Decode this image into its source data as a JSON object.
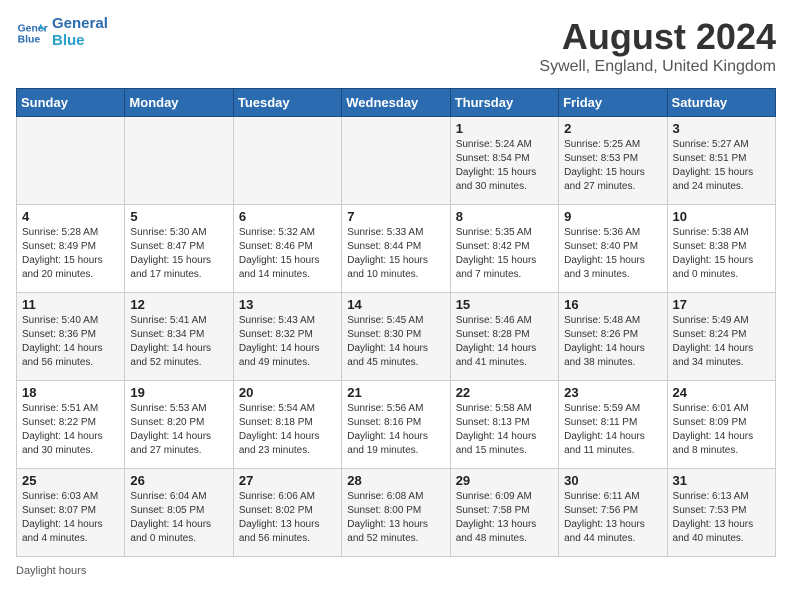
{
  "header": {
    "logo_line1": "General",
    "logo_line2": "Blue",
    "month_title": "August 2024",
    "location": "Sywell, England, United Kingdom"
  },
  "days_of_week": [
    "Sunday",
    "Monday",
    "Tuesday",
    "Wednesday",
    "Thursday",
    "Friday",
    "Saturday"
  ],
  "weeks": [
    [
      {
        "day": "",
        "content": ""
      },
      {
        "day": "",
        "content": ""
      },
      {
        "day": "",
        "content": ""
      },
      {
        "day": "",
        "content": ""
      },
      {
        "day": "1",
        "content": "Sunrise: 5:24 AM\nSunset: 8:54 PM\nDaylight: 15 hours\nand 30 minutes."
      },
      {
        "day": "2",
        "content": "Sunrise: 5:25 AM\nSunset: 8:53 PM\nDaylight: 15 hours\nand 27 minutes."
      },
      {
        "day": "3",
        "content": "Sunrise: 5:27 AM\nSunset: 8:51 PM\nDaylight: 15 hours\nand 24 minutes."
      }
    ],
    [
      {
        "day": "4",
        "content": "Sunrise: 5:28 AM\nSunset: 8:49 PM\nDaylight: 15 hours\nand 20 minutes."
      },
      {
        "day": "5",
        "content": "Sunrise: 5:30 AM\nSunset: 8:47 PM\nDaylight: 15 hours\nand 17 minutes."
      },
      {
        "day": "6",
        "content": "Sunrise: 5:32 AM\nSunset: 8:46 PM\nDaylight: 15 hours\nand 14 minutes."
      },
      {
        "day": "7",
        "content": "Sunrise: 5:33 AM\nSunset: 8:44 PM\nDaylight: 15 hours\nand 10 minutes."
      },
      {
        "day": "8",
        "content": "Sunrise: 5:35 AM\nSunset: 8:42 PM\nDaylight: 15 hours\nand 7 minutes."
      },
      {
        "day": "9",
        "content": "Sunrise: 5:36 AM\nSunset: 8:40 PM\nDaylight: 15 hours\nand 3 minutes."
      },
      {
        "day": "10",
        "content": "Sunrise: 5:38 AM\nSunset: 8:38 PM\nDaylight: 15 hours\nand 0 minutes."
      }
    ],
    [
      {
        "day": "11",
        "content": "Sunrise: 5:40 AM\nSunset: 8:36 PM\nDaylight: 14 hours\nand 56 minutes."
      },
      {
        "day": "12",
        "content": "Sunrise: 5:41 AM\nSunset: 8:34 PM\nDaylight: 14 hours\nand 52 minutes."
      },
      {
        "day": "13",
        "content": "Sunrise: 5:43 AM\nSunset: 8:32 PM\nDaylight: 14 hours\nand 49 minutes."
      },
      {
        "day": "14",
        "content": "Sunrise: 5:45 AM\nSunset: 8:30 PM\nDaylight: 14 hours\nand 45 minutes."
      },
      {
        "day": "15",
        "content": "Sunrise: 5:46 AM\nSunset: 8:28 PM\nDaylight: 14 hours\nand 41 minutes."
      },
      {
        "day": "16",
        "content": "Sunrise: 5:48 AM\nSunset: 8:26 PM\nDaylight: 14 hours\nand 38 minutes."
      },
      {
        "day": "17",
        "content": "Sunrise: 5:49 AM\nSunset: 8:24 PM\nDaylight: 14 hours\nand 34 minutes."
      }
    ],
    [
      {
        "day": "18",
        "content": "Sunrise: 5:51 AM\nSunset: 8:22 PM\nDaylight: 14 hours\nand 30 minutes."
      },
      {
        "day": "19",
        "content": "Sunrise: 5:53 AM\nSunset: 8:20 PM\nDaylight: 14 hours\nand 27 minutes."
      },
      {
        "day": "20",
        "content": "Sunrise: 5:54 AM\nSunset: 8:18 PM\nDaylight: 14 hours\nand 23 minutes."
      },
      {
        "day": "21",
        "content": "Sunrise: 5:56 AM\nSunset: 8:16 PM\nDaylight: 14 hours\nand 19 minutes."
      },
      {
        "day": "22",
        "content": "Sunrise: 5:58 AM\nSunset: 8:13 PM\nDaylight: 14 hours\nand 15 minutes."
      },
      {
        "day": "23",
        "content": "Sunrise: 5:59 AM\nSunset: 8:11 PM\nDaylight: 14 hours\nand 11 minutes."
      },
      {
        "day": "24",
        "content": "Sunrise: 6:01 AM\nSunset: 8:09 PM\nDaylight: 14 hours\nand 8 minutes."
      }
    ],
    [
      {
        "day": "25",
        "content": "Sunrise: 6:03 AM\nSunset: 8:07 PM\nDaylight: 14 hours\nand 4 minutes."
      },
      {
        "day": "26",
        "content": "Sunrise: 6:04 AM\nSunset: 8:05 PM\nDaylight: 14 hours\nand 0 minutes."
      },
      {
        "day": "27",
        "content": "Sunrise: 6:06 AM\nSunset: 8:02 PM\nDaylight: 13 hours\nand 56 minutes."
      },
      {
        "day": "28",
        "content": "Sunrise: 6:08 AM\nSunset: 8:00 PM\nDaylight: 13 hours\nand 52 minutes."
      },
      {
        "day": "29",
        "content": "Sunrise: 6:09 AM\nSunset: 7:58 PM\nDaylight: 13 hours\nand 48 minutes."
      },
      {
        "day": "30",
        "content": "Sunrise: 6:11 AM\nSunset: 7:56 PM\nDaylight: 13 hours\nand 44 minutes."
      },
      {
        "day": "31",
        "content": "Sunrise: 6:13 AM\nSunset: 7:53 PM\nDaylight: 13 hours\nand 40 minutes."
      }
    ]
  ],
  "footer": {
    "daylight_label": "Daylight hours"
  }
}
